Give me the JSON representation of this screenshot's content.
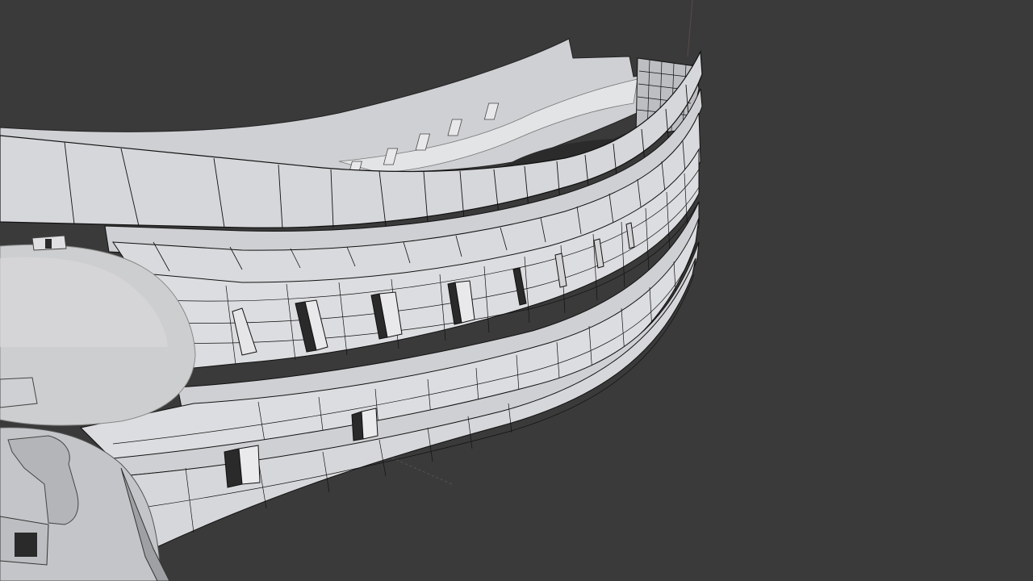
{
  "viewport": {
    "background": "#3a3a3a",
    "mode": "solid-wireframe-overlay",
    "object": "ship-hull-stern"
  },
  "colors": {
    "hull_light": "#dcdde0",
    "hull_mid": "#c8c9cc",
    "hull_shadow": "#a9aaad",
    "deck": "#bfc0c3",
    "wire": "#111111",
    "port_dark": "#2a2a2a"
  }
}
